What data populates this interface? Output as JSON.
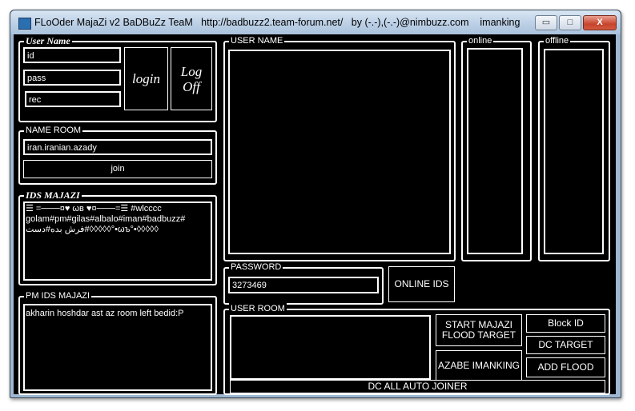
{
  "titlebar": {
    "title": "FLoOder MajaZi v2 BaDBuZz TeaM   http://badbuzz2.team-forum.net/   by (-.-),(-.-)@nimbuzz.com    imanking",
    "min_label": "▭",
    "max_label": "□",
    "close_label": "X"
  },
  "login_group": {
    "legend": "User Name",
    "id_value": "id",
    "pass_value": "pass",
    "rec_value": "rec",
    "login_label": "login",
    "logoff_label": "Log\nOff"
  },
  "room_group": {
    "legend": "NAME ROOM",
    "room_value": "iran.iranian.azady",
    "join_label": "join"
  },
  "ids_group": {
    "legend": "IDS MAJAZI",
    "text": "☰ =───¤♥ ωв ♥¤───=☰ #wlcccc\ngolam#pm#gilas#albalo#iman#badbuzz#\nفرش بده#دست#◊◊◊◊◊°•ωъ°•◊◊◊◊◊"
  },
  "pm_group": {
    "legend": "PM IDS MAJAZI",
    "text": "akharin hoshdar ast az room left bedid:P"
  },
  "username_group": {
    "legend": "USER NAME"
  },
  "online_group": {
    "legend": "online"
  },
  "offline_group": {
    "legend": "offline"
  },
  "password_group": {
    "legend": "PASSWORD",
    "value": "3273469"
  },
  "online_ids_label": "ONLINE IDS",
  "userroom_group": {
    "legend": "USER ROOM",
    "start_label": "START MAJAZI\nFLOOD TARGET",
    "azabe_label": "AZABE IMANKING",
    "block_label": "Block ID",
    "dc_target_label": "DC TARGET",
    "add_flood_label": "ADD FLOOD",
    "dc_all_label": "DC ALL AUTO JOINER"
  }
}
